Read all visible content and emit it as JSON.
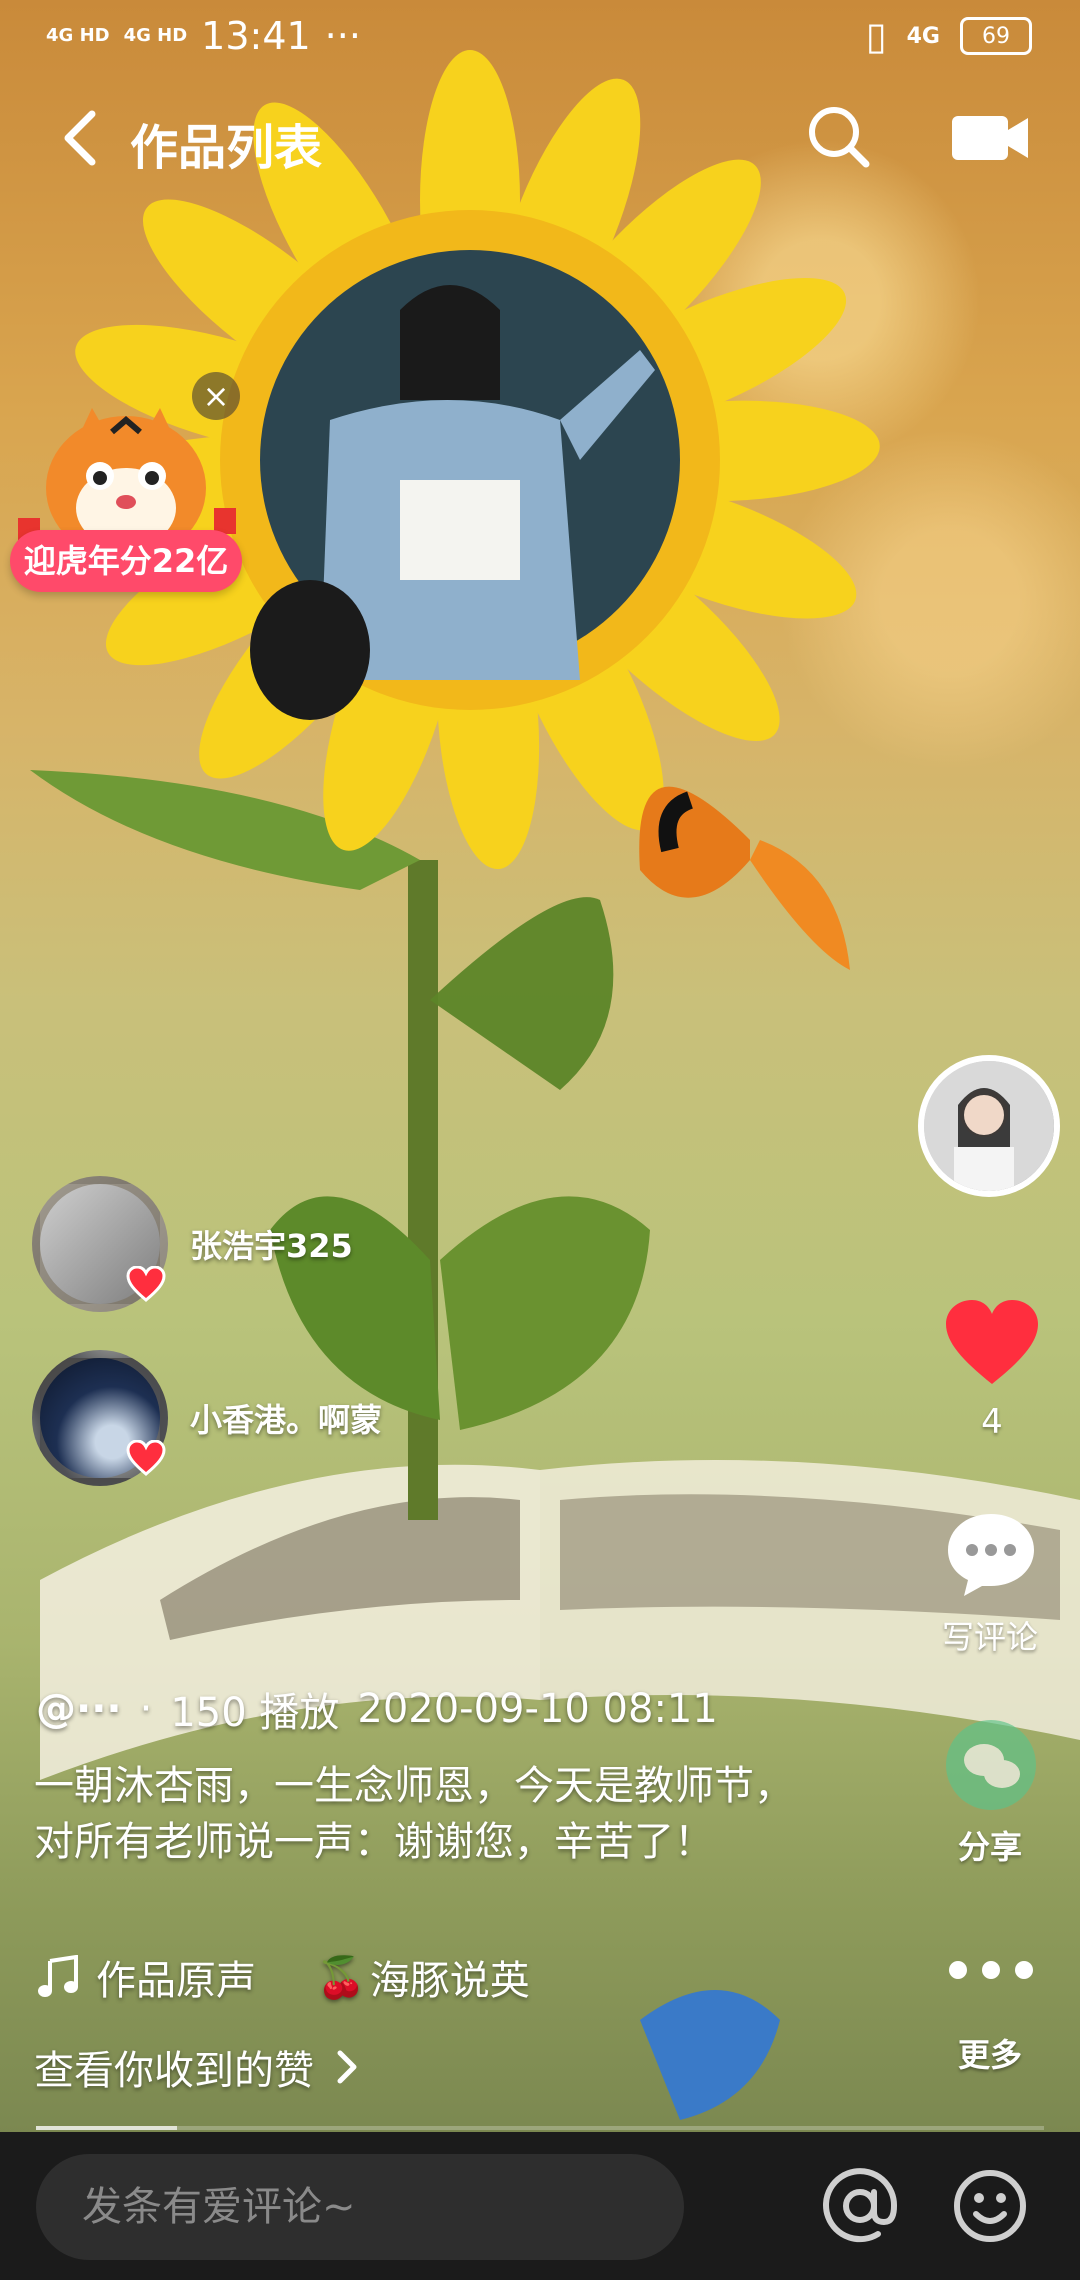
{
  "status_bar": {
    "network1": "4G HD",
    "network2": "4G HD",
    "time": "13:41",
    "dots": "···",
    "signal": "4G",
    "battery": "69"
  },
  "header": {
    "title": "作品列表"
  },
  "promo": {
    "label": "迎虎年分22亿"
  },
  "rail": {
    "like_count": "4",
    "comment_label": "写评论",
    "share_label": "分享",
    "more_label": "更多"
  },
  "likers": [
    {
      "name": "张浩宇325"
    },
    {
      "name": "小香港。啊蒙"
    }
  ],
  "post": {
    "author": "@···",
    "dot": "·",
    "plays": "150 播放",
    "date": "2020-09-10 08:11",
    "caption": "一朝沐杏雨，一生念师恩，今天是教师节，对所有老师说一声：谢谢您，辛苦了！",
    "music_original": "作品原声",
    "music_other": "海豚说英",
    "view_likes": "查看你收到的赞"
  },
  "progress": {
    "fraction": 0.14
  },
  "bottom": {
    "comment_placeholder": "发条有爱评论~"
  },
  "colors": {
    "like": "#ff2e3e",
    "promo": "#ff4a6a",
    "bottom_bar": "#1b1b1b"
  }
}
